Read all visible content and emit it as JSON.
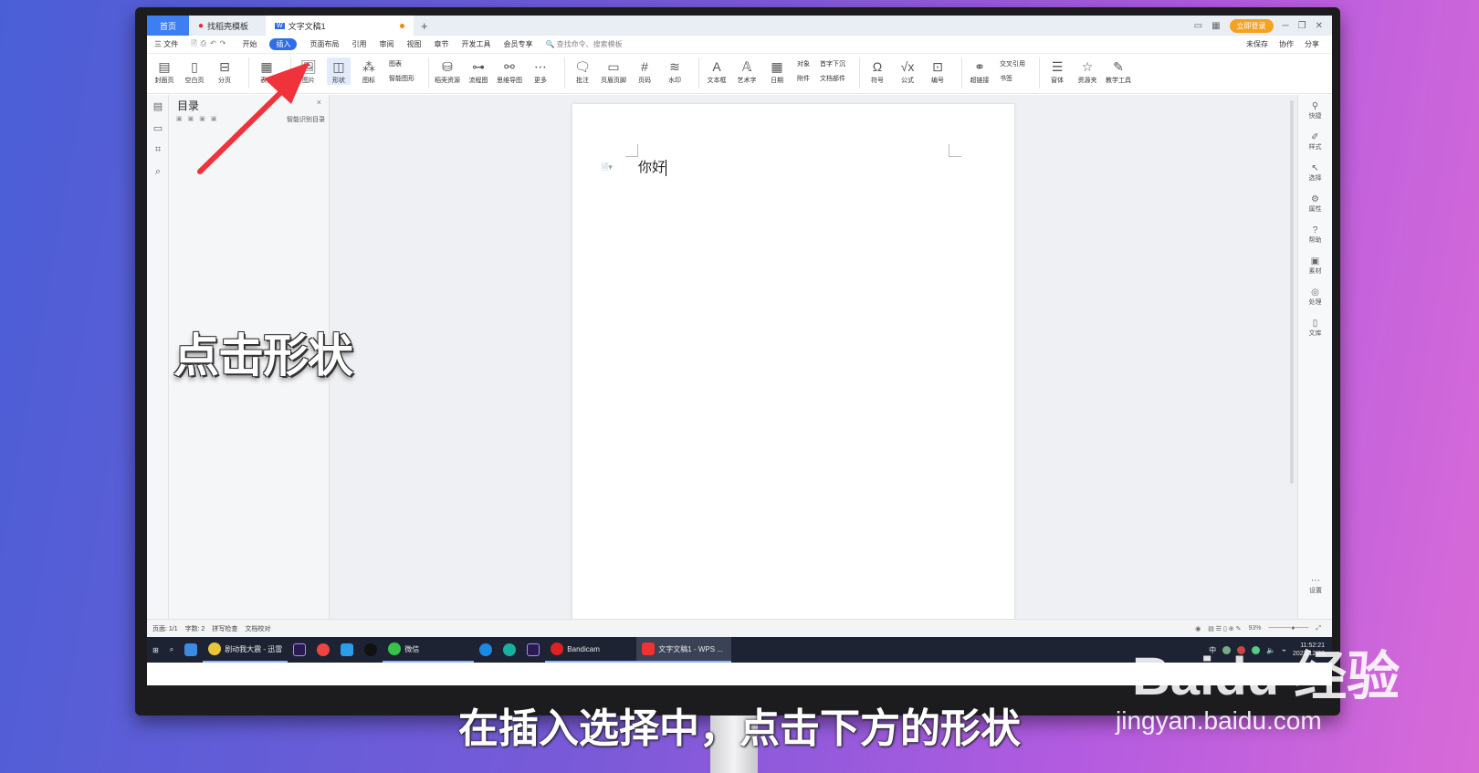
{
  "tabs": {
    "home": "首页",
    "template": "找稻壳模板",
    "doc": "文字文稿1",
    "plus": "+"
  },
  "login": "立即登录",
  "menu": {
    "file": "三 文件",
    "items": [
      "开始",
      "插入",
      "页面布局",
      "引用",
      "审阅",
      "视图",
      "章节",
      "开发工具",
      "会员专享"
    ],
    "active": "插入",
    "search": "查找命令、搜索模板",
    "right": [
      "未保存",
      "协作",
      "分享"
    ]
  },
  "ribbon": {
    "buttons": [
      "封面页",
      "空白页",
      "分页",
      "表格",
      "图片",
      "形状",
      "图标",
      "稻壳资源",
      "流程图",
      "思维导图",
      "更多",
      "批注",
      "页眉页脚",
      "页码",
      "水印",
      "文本框",
      "艺术字",
      "日期",
      "符号",
      "公式",
      "编号",
      "超链接",
      "窗体",
      "资源夹",
      "教学工具"
    ],
    "small": {
      "chart": "图表",
      "smart": "智能图形",
      "object": "对象",
      "attach": "附件",
      "dropcap": "首字下沉",
      "docpart": "文档部件",
      "crossref": "交叉引用",
      "bookmark": "书签"
    }
  },
  "toc": {
    "title": "目录",
    "smart_toc": "智能识别目录",
    "close": "×"
  },
  "document": {
    "text": "你好"
  },
  "right_rail": [
    "快捷",
    "样式",
    "选择",
    "属性",
    "帮助",
    "素材",
    "处理",
    "文库",
    "设置"
  ],
  "status": {
    "page": "页面: 1/1",
    "words": "字数: 2",
    "spell": "拼写检查",
    "proof": "文档校对",
    "zoom": "93%"
  },
  "taskbar": {
    "apps": [
      "剧动我大震 - 迅雷",
      "微信",
      "Bandicam",
      "文字文稿1 - WPS ..."
    ],
    "time": "11:52:21",
    "date": "2022/12/20",
    "ime": "中"
  },
  "overlay": {
    "label": "点击形状",
    "subtitle": "在插入选择中，点击下方的形状"
  },
  "watermark": {
    "brand": "Baidu 经验",
    "url": "jingyan.baidu.com"
  },
  "colors": {
    "accent": "#2f6ee8",
    "arrow": "#f0323a",
    "login": "#f4a320"
  }
}
